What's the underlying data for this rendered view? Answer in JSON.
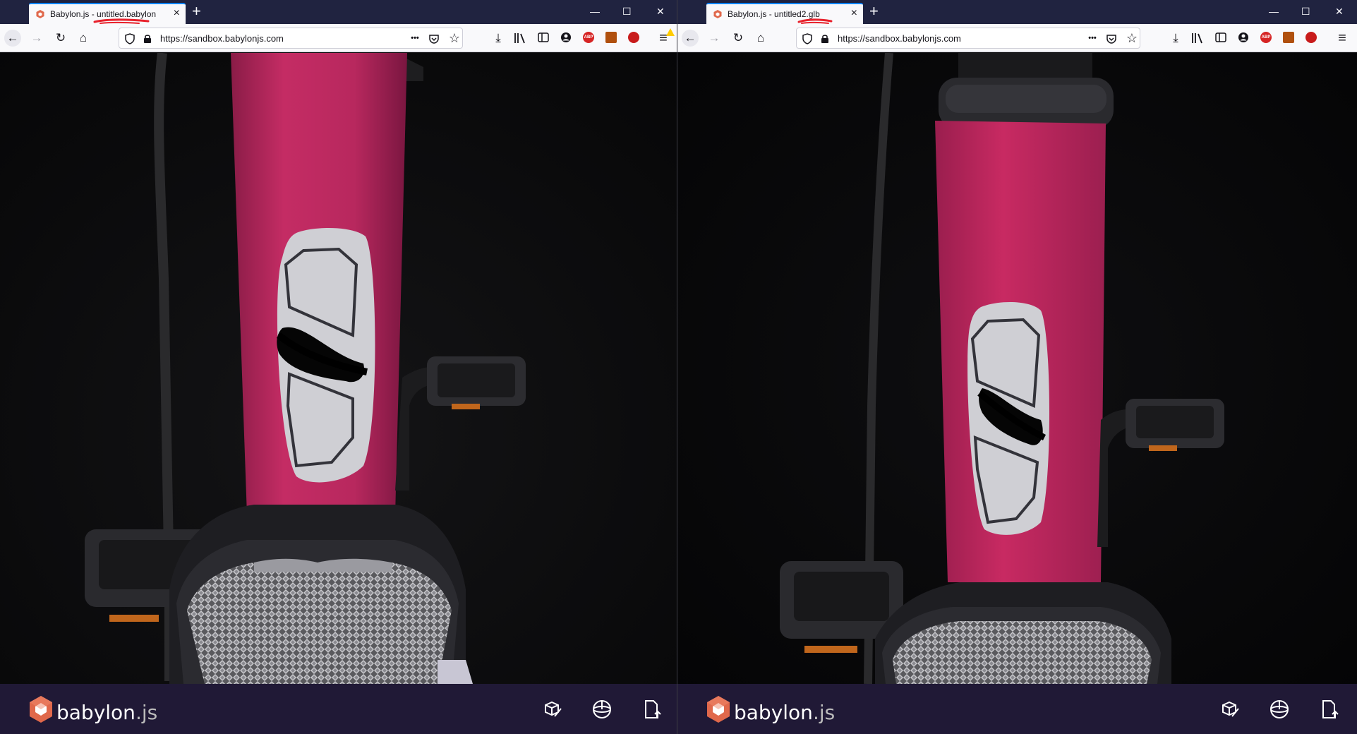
{
  "windows": [
    {
      "tab_title": "Babylon.js - untitled.babylon",
      "url": "https://sandbox.babylonjs.com",
      "brand": "babylon",
      "brand_ext": ".js"
    },
    {
      "tab_title": "Babylon.js - untitled2.glb",
      "url": "https://sandbox.babylonjs.com",
      "brand": "babylon",
      "brand_ext": ".js"
    }
  ],
  "icons": {
    "tab_close": "×",
    "new_tab": "+",
    "minimize": "—",
    "maximize": "☐",
    "close_window": "✕",
    "back": "←",
    "forward": "→",
    "reload": "↻",
    "home": "⌂",
    "page_actions": "•••",
    "star": "☆",
    "download": "⤓",
    "menu": "≡"
  },
  "colors": {
    "tab_accent": "#0a84ff",
    "footer_bg": "#201936",
    "frame_pink": "#b8285e",
    "annotation_red": "#e8212b"
  }
}
